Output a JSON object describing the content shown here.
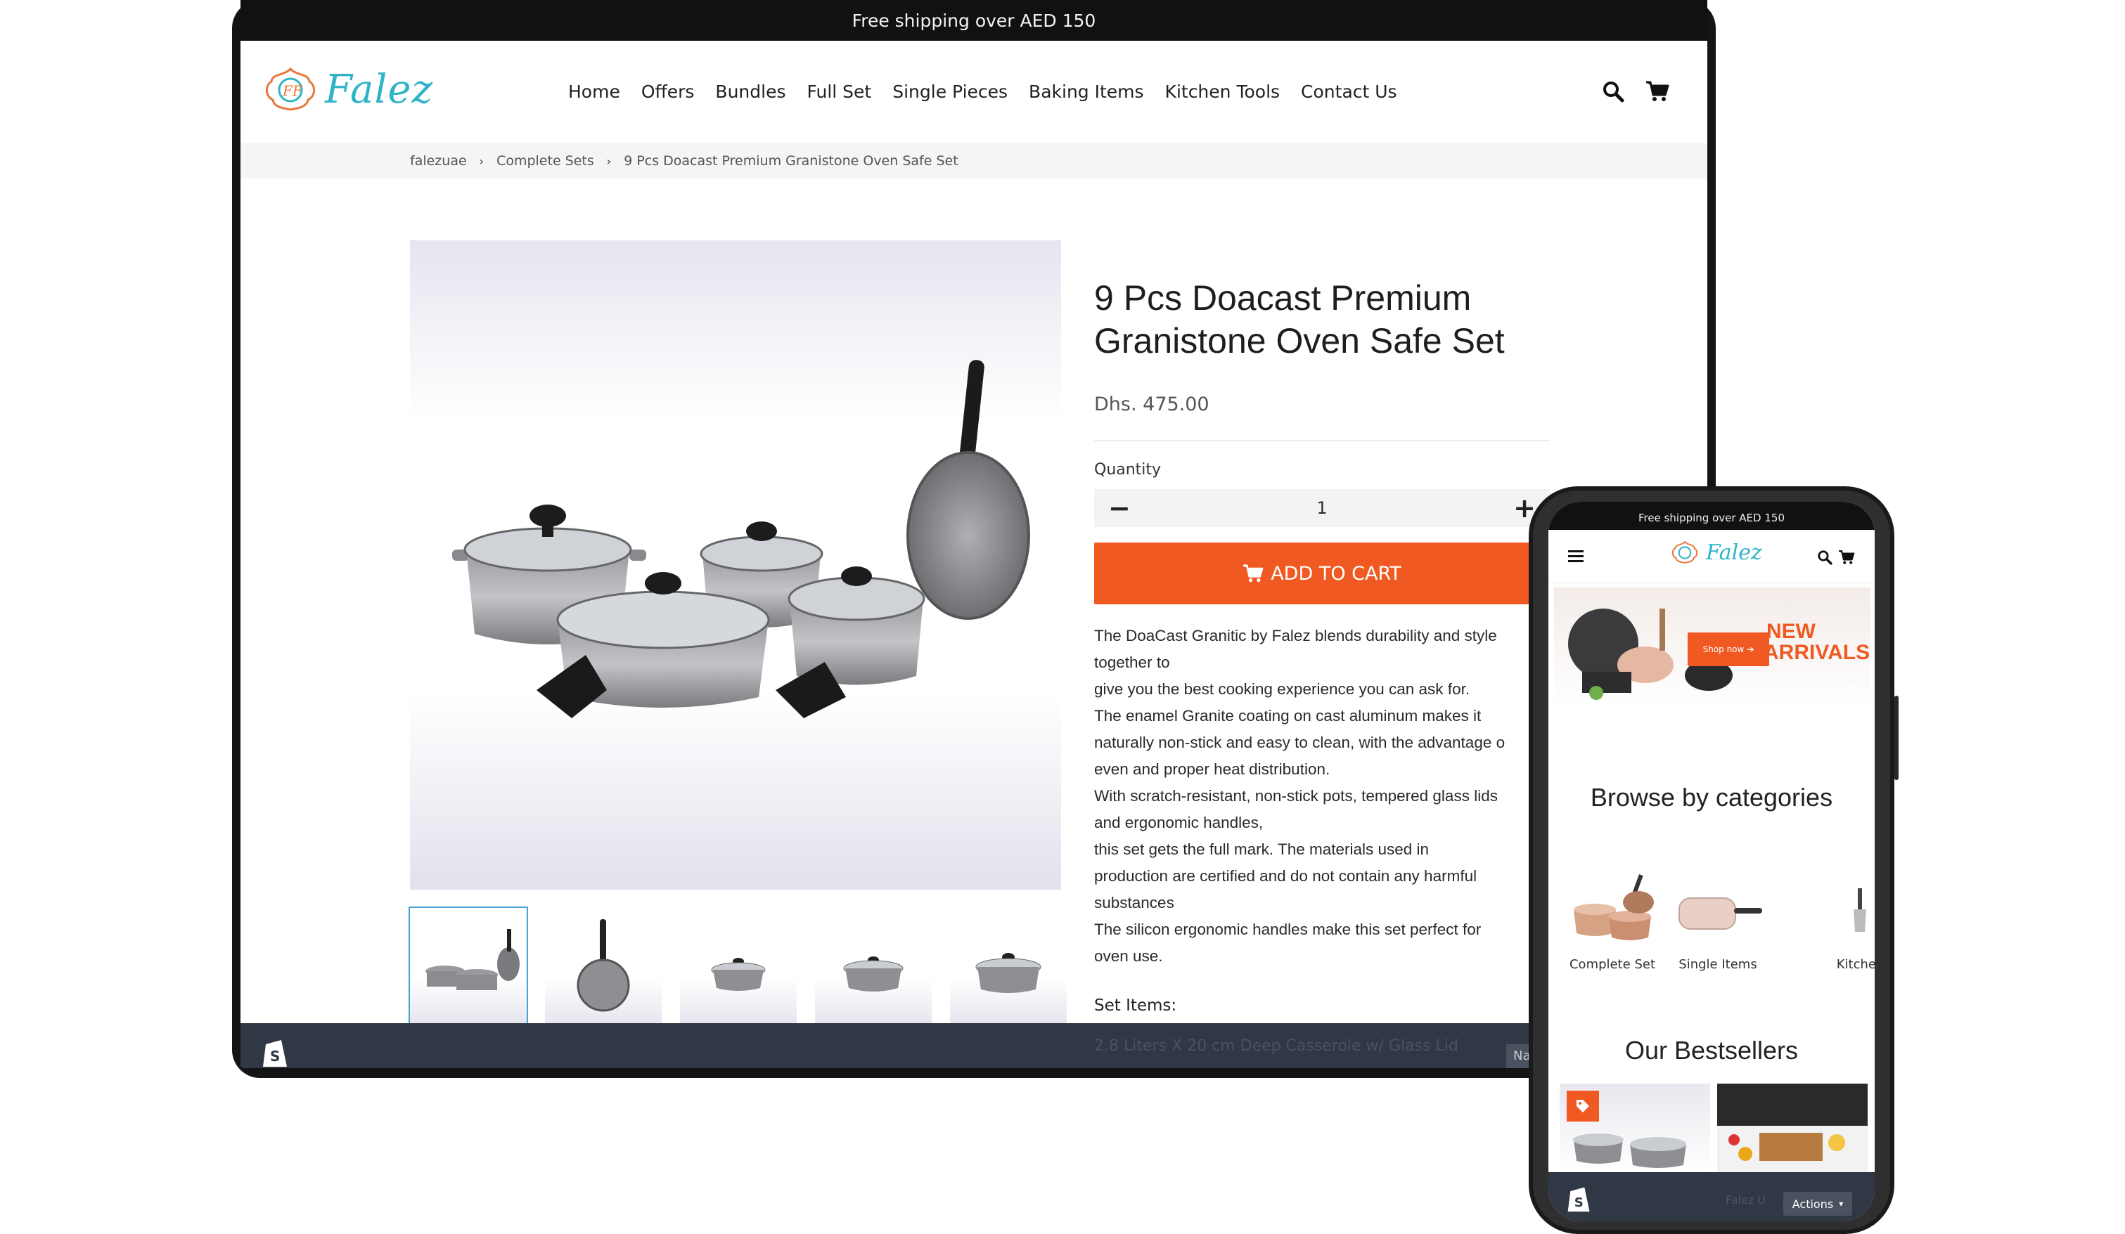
{
  "tablet": {
    "announcement": "Free shipping over AED 150",
    "brand": "Falez",
    "nav": [
      "Home",
      "Offers",
      "Bundles",
      "Full Set",
      "Single Pieces",
      "Baking Items",
      "Kitchen Tools",
      "Contact Us"
    ],
    "breadcrumb": [
      "falezuae",
      "Complete Sets",
      "9 Pcs Doacast Premium Granistone Oven Safe Set"
    ],
    "product": {
      "title_line1": "9 Pcs Doacast Premium",
      "title_line2": "Granistone Oven Safe Set",
      "price": "Dhs. 475.00",
      "quantity_label": "Quantity",
      "quantity_value": "1",
      "add_to_cart": "ADD TO CART",
      "description": [
        "The DoaCast Granitic by Falez blends durability and style",
        "together to",
        "give you the best cooking experience you can ask for.",
        "The enamel Granite coating on cast aluminum makes it",
        "naturally non-stick and easy to clean, with the advantage o",
        "even and proper heat distribution.",
        "With scratch-resistant, non-stick pots, tempered glass lids",
        "and ergonomic handles,",
        "this set gets the full mark. The materials used in",
        "production are certified and do not contain any harmful",
        "substances",
        "The silicon ergonomic handles make this set perfect for",
        "oven use."
      ],
      "set_items_label": "Set Items:",
      "set_item_1": "2.8 Liters  X 20 cm Deep Casserole w/ Glass Lid"
    },
    "admin_nav_button": "Nav"
  },
  "phone": {
    "announcement": "Free shipping over AED 150",
    "brand": "Falez",
    "banner_button": "Shop now",
    "banner_title_1": "NEW",
    "banner_title_2": "ARRIVALS",
    "browse_title": "Browse by categories",
    "categories": [
      "Complete Set",
      "Single Items",
      "Kitche"
    ],
    "bestsellers_title": "Our Bestsellers",
    "admin_faded": "Falez U",
    "actions_button": "Actions"
  },
  "colors": {
    "accent": "#f05a22",
    "admin_bar": "#303845",
    "brand_teal": "#2fb3c9",
    "brand_orange": "#e9773a"
  },
  "icons": [
    "search-icon",
    "cart-icon",
    "menu-icon",
    "shopify-icon",
    "tag-icon",
    "arrow-right-icon",
    "chevron-right-icon",
    "minus-icon",
    "plus-icon",
    "chevron-down-icon"
  ]
}
